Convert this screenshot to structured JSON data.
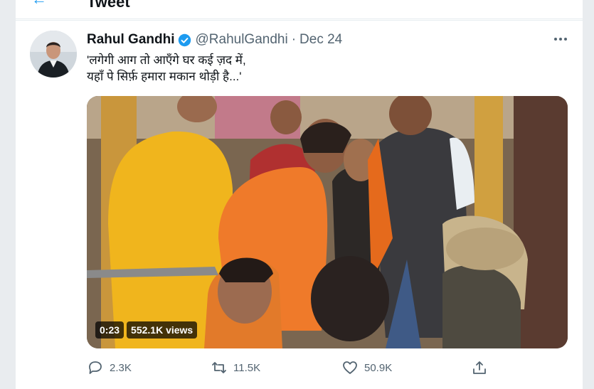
{
  "header": {
    "back_icon": "arrow-left-icon",
    "title": "Tweet"
  },
  "tweet": {
    "author_name": "Rahul Gandhi",
    "handle": "@RahulGandhi",
    "separator": "·",
    "date": "Dec 24",
    "text_lines": [
      "'लगेगी आग तो आएँगे घर कई ज़द में,",
      "यहाँ पे सिर्फ़ हमारा मकान थोड़ी है...'"
    ],
    "media": {
      "duration": "0:23",
      "views": "552.1K views"
    },
    "actions": {
      "reply_count": "2.3K",
      "retweet_count": "11.5K",
      "like_count": "50.9K"
    }
  },
  "colors": {
    "accent": "#1d9bf0",
    "muted": "#536471",
    "text": "#0f1419"
  }
}
